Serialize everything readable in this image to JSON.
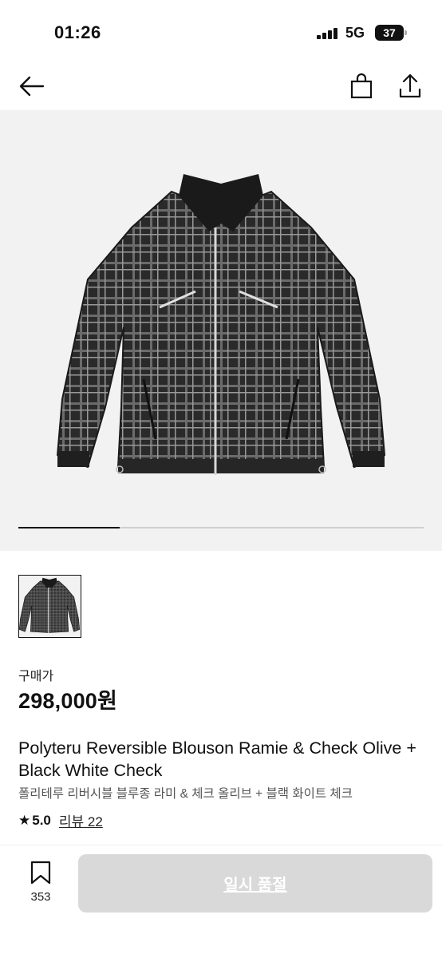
{
  "status_bar": {
    "time": "01:26",
    "network": "5G",
    "battery": "37"
  },
  "header": {
    "back_icon": "arrow-left-icon",
    "bag_icon": "shopping-bag-icon",
    "share_icon": "share-icon"
  },
  "gallery": {
    "image": "black-white-check-zip-jacket",
    "progress": 0.25
  },
  "price": {
    "label": "구매가",
    "value": "298,000원"
  },
  "product": {
    "name_en": "Polyteru Reversible Blouson Ramie & Check Olive + Black White Check",
    "name_ko": "폴리테루 리버시블 블루종 라미 & 체크 올리브 + 블랙 화이트 체크",
    "rating": "5.0",
    "review_label": "리뷰 22"
  },
  "bottom_bar": {
    "wish_count": "353",
    "buy_label": "일시 품절"
  },
  "colors": {
    "button_disabled": "#d9d9d9",
    "gallery_bg": "#f2f2f2"
  }
}
